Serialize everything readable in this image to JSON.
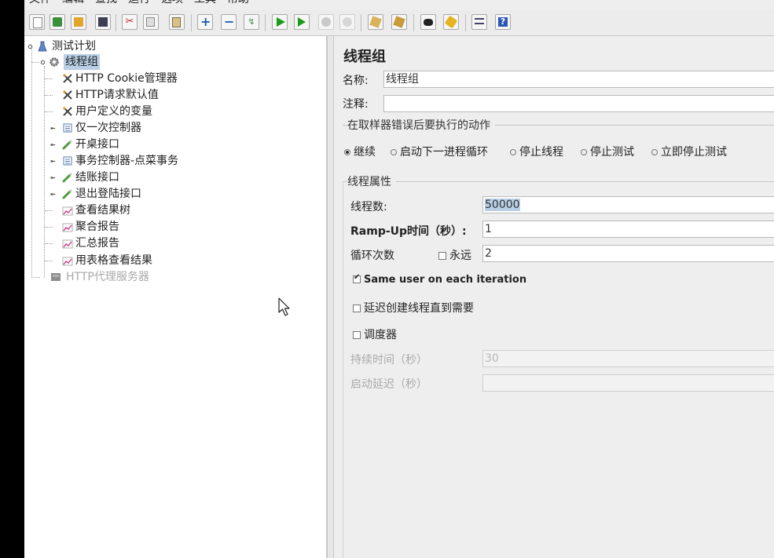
{
  "menu": [
    "文件",
    "编辑",
    "查找",
    "运行",
    "选项",
    "工具",
    "帮助"
  ],
  "toolbar_icons": [
    "new-icon",
    "templates-icon",
    "open-icon",
    "save-icon",
    "cut-icon",
    "copy-icon",
    "paste-icon",
    "expand-icon",
    "collapse-icon",
    "toggle-icon",
    "start-icon",
    "start-no-pause-icon",
    "stop-icon",
    "shutdown-icon",
    "clear-icon",
    "clear-all-icon",
    "search-icon",
    "reset-search-icon",
    "function-helper-icon",
    "help-icon"
  ],
  "tree": {
    "root": "测试计划",
    "thread_group": "线程组",
    "children": [
      {
        "label": "HTTP Cookie管理器",
        "icon": "config-icon"
      },
      {
        "label": "HTTP请求默认值",
        "icon": "config-icon"
      },
      {
        "label": "用户定义的变量",
        "icon": "config-icon"
      },
      {
        "label": "仅一次控制器",
        "icon": "controller-icon"
      },
      {
        "label": "开桌接口",
        "icon": "sampler-icon"
      },
      {
        "label": "事务控制器-点菜事务",
        "icon": "controller-icon"
      },
      {
        "label": "结账接口",
        "icon": "sampler-icon"
      },
      {
        "label": "退出登陆接口",
        "icon": "sampler-icon"
      },
      {
        "label": "查看结果树",
        "icon": "listener-icon"
      },
      {
        "label": "聚合报告",
        "icon": "listener-icon"
      },
      {
        "label": "汇总报告",
        "icon": "listener-icon"
      },
      {
        "label": "用表格查看结果",
        "icon": "listener-icon"
      }
    ],
    "proxy": "HTTP代理服务器"
  },
  "panel": {
    "title": "线程组",
    "name_label": "名称:",
    "name_value": "线程组",
    "comment_label": "注释:",
    "comment_value": "",
    "error_group_title": "在取样器错误后要执行的动作",
    "error_actions": [
      "继续",
      "启动下一进程循环",
      "停止线程",
      "停止测试",
      "立即停止测试"
    ],
    "error_selected": "继续",
    "props_group_title": "线程属性",
    "threads_label": "线程数:",
    "threads_value": "50000",
    "rampup_label": "Ramp-Up时间（秒）:",
    "rampup_value": "1",
    "loop_label": "循环次数",
    "forever_label": "永远",
    "forever_checked": false,
    "loop_value": "2",
    "same_user_label": "Same user on each iteration",
    "same_user_checked": true,
    "delay_label": "延迟创建线程直到需要",
    "delay_checked": false,
    "scheduler_label": "调度器",
    "scheduler_checked": false,
    "duration_label": "持续时间（秒）",
    "duration_value": "30",
    "startup_delay_label": "启动延迟（秒）",
    "startup_delay_value": ""
  },
  "colors": {
    "selection": "#b8cfe5",
    "disabled_text": "#aaaaaa",
    "panel_bg": "#eeeeee"
  }
}
